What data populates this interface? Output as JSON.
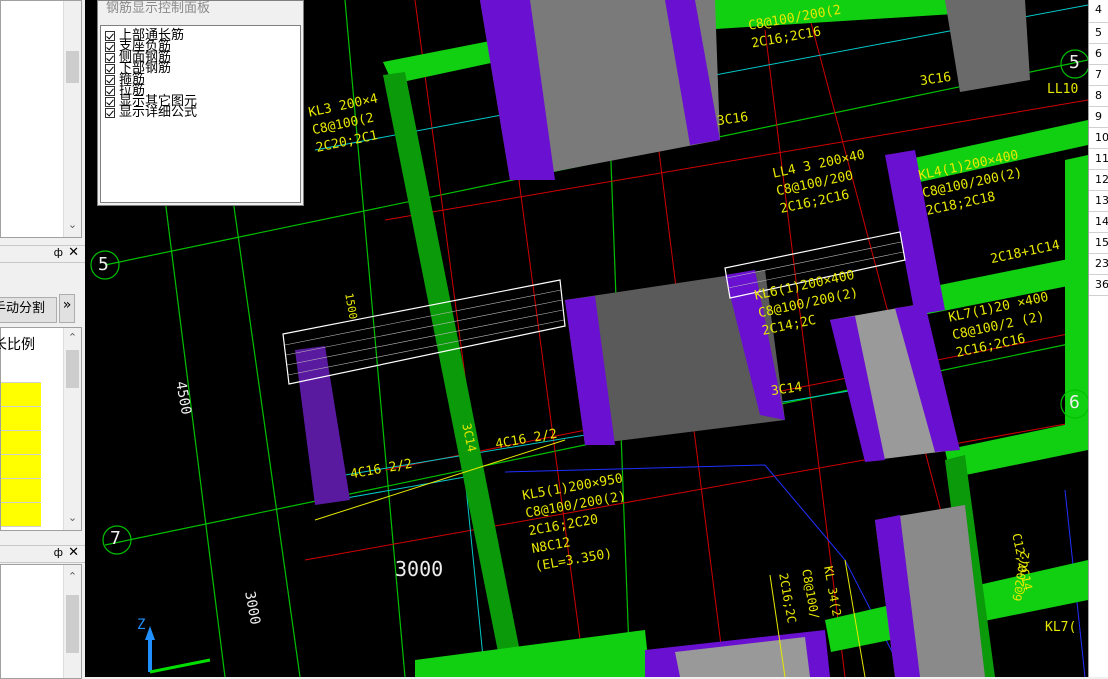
{
  "left_panel": {
    "toolbar": {
      "split_button": "手动分割",
      "more_button": "»"
    },
    "column_header": "长比例",
    "pin_glyph": "ф",
    "close_glyph": "✕"
  },
  "rebar_panel": {
    "title": "钢筋显示控制面板",
    "items": [
      {
        "label": "上部通长筋",
        "checked": true
      },
      {
        "label": "支座负筋",
        "checked": true
      },
      {
        "label": "侧面钢筋",
        "checked": true
      },
      {
        "label": "下部钢筋",
        "checked": true
      },
      {
        "label": "箍筋",
        "checked": true
      },
      {
        "label": "拉筋",
        "checked": true
      },
      {
        "label": "显示其它图元",
        "checked": true
      },
      {
        "label": "显示详细公式",
        "checked": true
      }
    ]
  },
  "right_panel": {
    "rows": [
      "4",
      "5",
      "6",
      "7",
      "8",
      "9",
      "10",
      "11",
      "12",
      "13",
      "14",
      "15",
      "23",
      "36"
    ]
  },
  "canvas": {
    "axis_labels": {
      "a5": "5",
      "a7": "7",
      "r5": "5",
      "r6": "6"
    },
    "dims": {
      "d4500": "4500",
      "d3000a": "3000",
      "d3000b": "3000"
    },
    "beams": {
      "kl5": [
        "KL5(1)200×950",
        "C8@100/200(2)",
        "2C16;2C20",
        "N8C12",
        "(EL=3.350)"
      ],
      "ll4_3": [
        "LL4 3 200×40",
        "C8@100/200",
        "2C16;2C16"
      ],
      "kl4": [
        "KL4(1)200×400",
        "C8@100/200(2)",
        "2C18;2C18"
      ],
      "kl6": [
        "KL6(1)200×400",
        "C8@100/200(2)",
        "2C14;2C"
      ],
      "kl7": [
        "KL7(1)20 ×400",
        "C8@100/2 (2)",
        "2C16;2C16"
      ],
      "kl3": [
        "KL3 200×4",
        "C8@100(2",
        "2C20;2C1"
      ],
      "top": [
        "C8@100/200(2",
        "2C16;2C16"
      ],
      "misc": [
        "3C16",
        "3C16",
        "3C14",
        "4C16 2/2",
        "4C16 2/2",
        "3C14",
        "2C18+1C14",
        "LL10",
        "KL 34(2",
        "C8@100/",
        "2C16;2C",
        "6@200(2",
        "C12;2C14",
        "KL7(",
        "1500"
      ]
    },
    "ucs": {
      "z": "Z"
    }
  }
}
